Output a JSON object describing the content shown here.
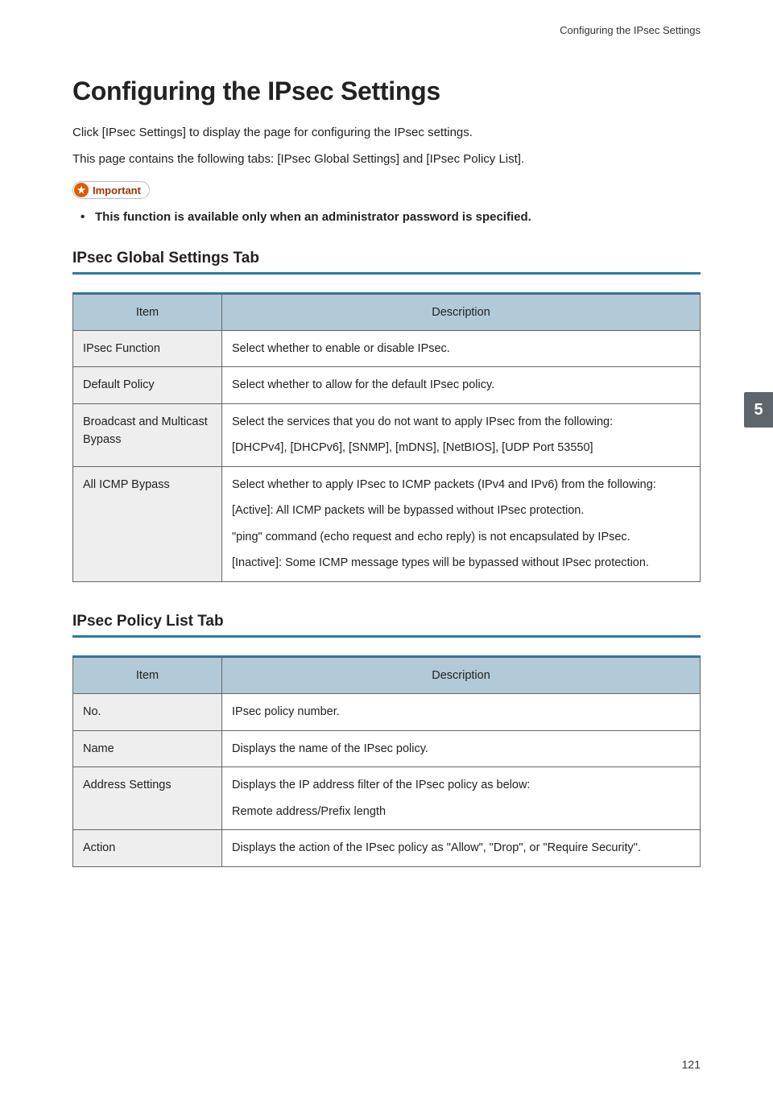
{
  "running_head": "Configuring the IPsec Settings",
  "page_title": "Configuring the IPsec Settings",
  "intro_line1": "Click [IPsec Settings] to display the page for configuring the IPsec settings.",
  "intro_line2": "This page contains the following tabs: [IPsec Global Settings] and [IPsec Policy List].",
  "important_label": "Important",
  "important_bullet": "This function is available only when an administrator password is specified.",
  "side_tab": "5",
  "page_number": "121",
  "sections": [
    {
      "title": "IPsec Global Settings Tab",
      "col_item": "Item",
      "col_desc": "Description",
      "rows": [
        {
          "item": "IPsec Function",
          "desc": [
            "Select whether to enable or disable IPsec."
          ]
        },
        {
          "item": "Default Policy",
          "desc": [
            "Select whether to allow for the default IPsec policy."
          ]
        },
        {
          "item": "Broadcast and Multicast Bypass",
          "desc": [
            "Select the services that you do not want to apply IPsec from the following:",
            "[DHCPv4], [DHCPv6], [SNMP], [mDNS], [NetBIOS], [UDP Port 53550]"
          ]
        },
        {
          "item": "All ICMP Bypass",
          "desc": [
            "Select whether to apply IPsec to ICMP packets (IPv4 and IPv6) from the following:",
            "[Active]: All ICMP packets will be bypassed without IPsec protection.",
            "\"ping\" command (echo request and echo reply) is not encapsulated by IPsec.",
            "[Inactive]: Some ICMP message types will be bypassed without IPsec protection."
          ]
        }
      ]
    },
    {
      "title": "IPsec Policy List Tab",
      "col_item": "Item",
      "col_desc": "Description",
      "rows": [
        {
          "item": "No.",
          "desc": [
            "IPsec policy number."
          ]
        },
        {
          "item": "Name",
          "desc": [
            "Displays the name of the IPsec policy."
          ]
        },
        {
          "item": "Address Settings",
          "desc": [
            "Displays the IP address filter of the IPsec policy as below:",
            "Remote address/Prefix length"
          ]
        },
        {
          "item": "Action",
          "desc": [
            "Displays the action of the IPsec policy as \"Allow\", \"Drop\", or \"Require Security\"."
          ]
        }
      ]
    }
  ]
}
